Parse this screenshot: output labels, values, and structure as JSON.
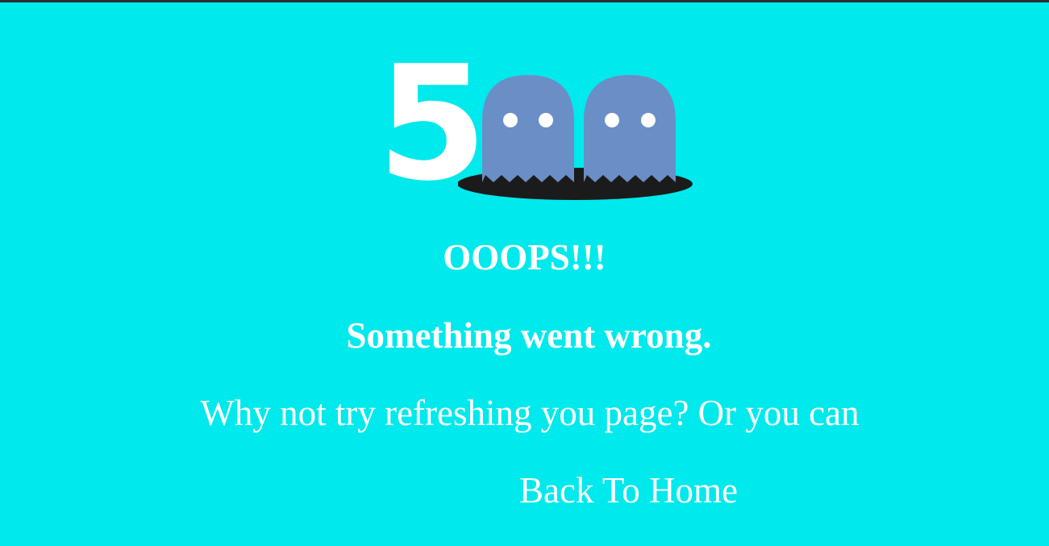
{
  "error": {
    "code_digit": "5",
    "title": "OOOPS!!!",
    "subtitle": "Something went wrong.",
    "message": "Why not try refreshing you page? Or you can",
    "home_link_label": "Back To Home"
  },
  "colors": {
    "background": "#00e9ec",
    "text": "#ffffff",
    "ghost": "#6a8ec6",
    "hole": "#1b1b1b",
    "top_bar": "#2b2d33"
  },
  "icons": [
    "ghost-icon",
    "hole-icon"
  ]
}
